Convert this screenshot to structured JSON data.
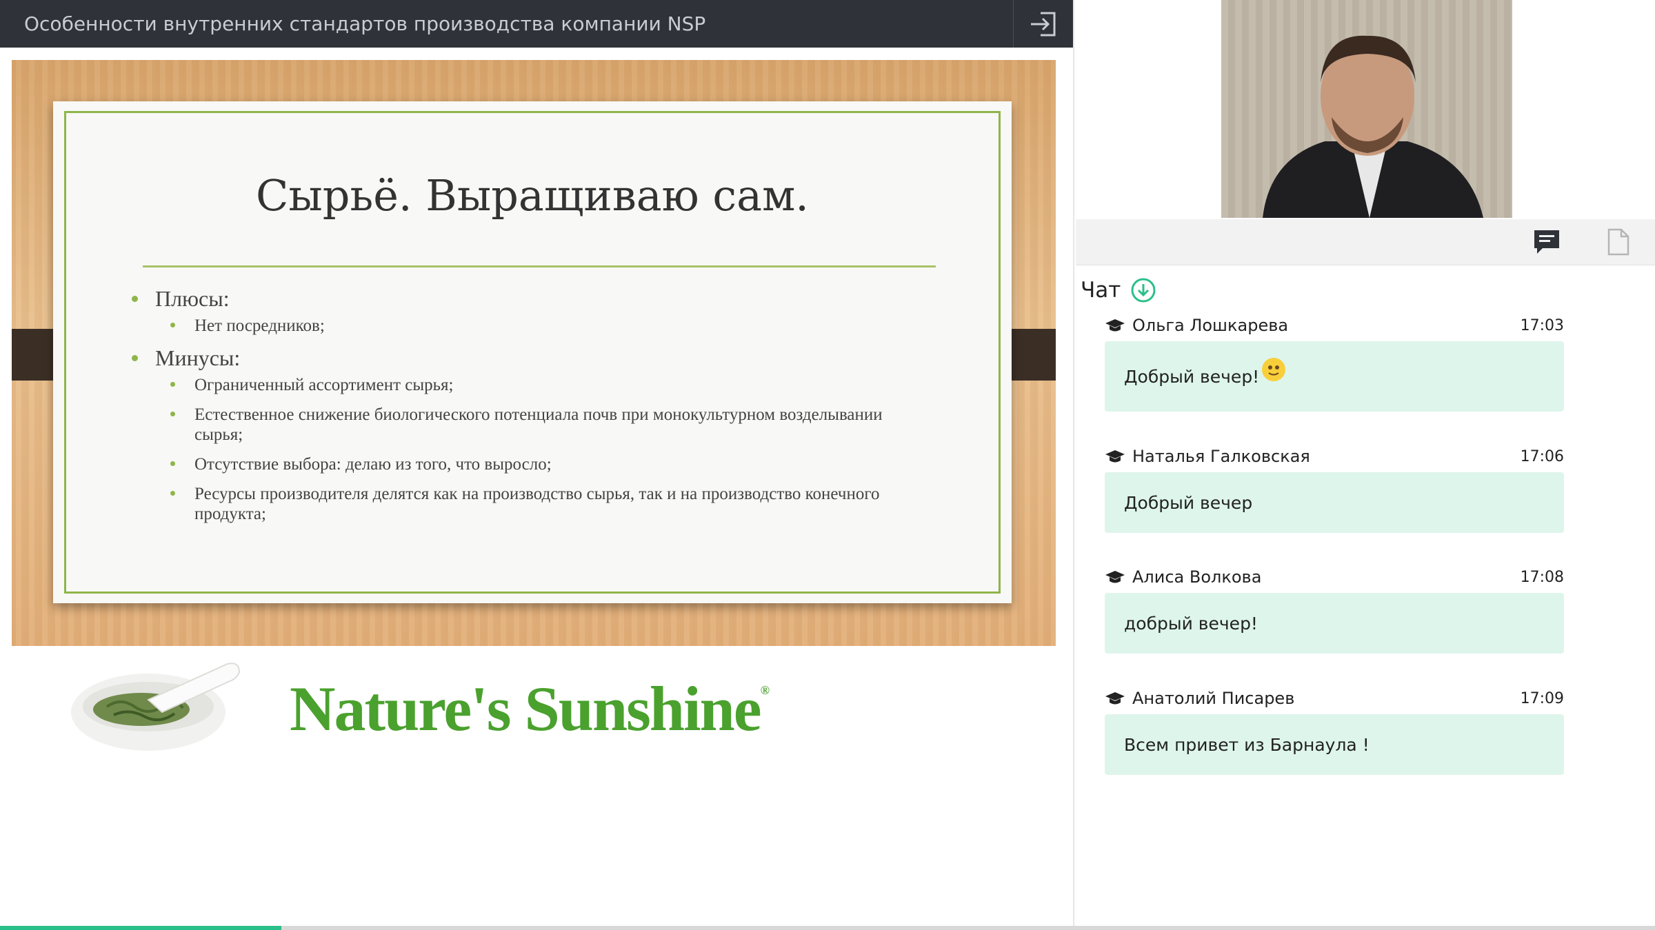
{
  "header": {
    "title": "Особенности внутренних стандартов производства компании NSP",
    "exit_icon": "exit-icon"
  },
  "slide": {
    "title": "Сырьё. Выращиваю сам.",
    "sections": [
      {
        "heading": "Плюсы:",
        "items": [
          "Нет посредников;"
        ]
      },
      {
        "heading": "Минусы:",
        "items": [
          "Ограниченный ассортимент сырья;",
          "Естественное снижение биологического потенциала почв при монокультурном возделывании сырья;",
          "Отсутствие выбора: делаю из того, что выросло;",
          "Ресурсы производителя делятся как на производство сырья, так и на производство конечного продукта;"
        ]
      }
    ]
  },
  "brand": {
    "logo_text": "Nature's Sunshine",
    "trademark": "®"
  },
  "toolbar": {
    "chat_icon": "chat-icon",
    "document_icon": "document-icon"
  },
  "chat": {
    "label": "Чат",
    "messages": [
      {
        "author": "Ольга Лошкарева",
        "time": "17:03",
        "text": "Добрый вечер!",
        "emoji": "smiley-emoji"
      },
      {
        "author": "Наталья Галковская",
        "time": "17:06",
        "text": "Добрый вечер"
      },
      {
        "author": "Алиса Волкова",
        "time": "17:08",
        "text": "добрый вечер!"
      },
      {
        "author": "Анатолий Писарев",
        "time": "17:09",
        "text": "Всем привет из Барнаула !"
      }
    ]
  },
  "progress": {
    "fraction": 0.17
  },
  "colors": {
    "accent": "#2bbf8a",
    "bubble": "#def5eb",
    "slide_green": "#8fb54a",
    "topbar": "#2f3238"
  }
}
